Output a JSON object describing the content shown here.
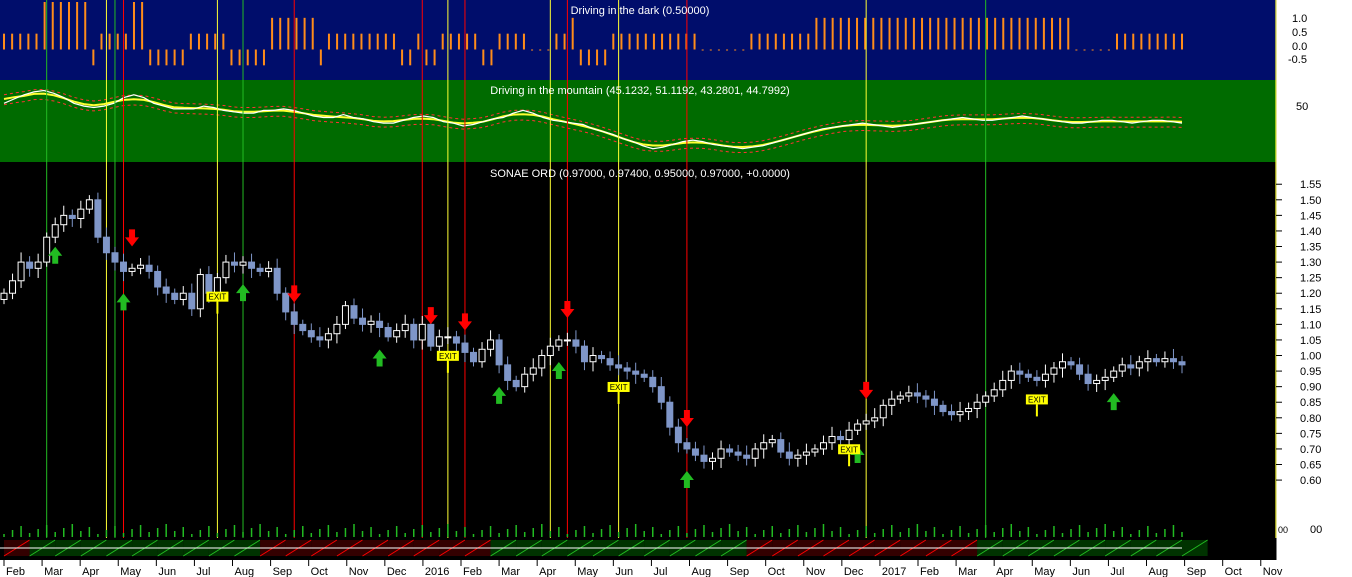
{
  "panels": {
    "dark": {
      "title": "Driving in the dark (0.50000)",
      "ticks": [
        "1.0",
        "0.5",
        "0.0",
        "-0.5"
      ],
      "ylim": [
        -0.9,
        1.5
      ]
    },
    "mountain": {
      "title": "Driving in the mountain (45.1232, 51.1192, 43.2801, 44.7992)",
      "ticks": [
        "50"
      ],
      "ylim": [
        20,
        75
      ]
    },
    "price": {
      "title": "SONAE ORD (0.97000, 0.97400, 0.95000, 0.97000, +0.0000)"
    }
  },
  "colors": {
    "dark_bg": "#000d6b",
    "mountain_bg": "#006b00",
    "price_bg": "#000000",
    "up_candle": "#ffffff",
    "down_candle": "#7f96c8",
    "orange": "#ff8c1a",
    "yellow": "#ffff33",
    "buy": "#22bb22",
    "sell": "#ff0000",
    "exit_bg": "#ffff00"
  },
  "x_axis": {
    "labels": [
      "Feb",
      "Mar",
      "Apr",
      "May",
      "Jun",
      "Jul",
      "Aug",
      "Sep",
      "Oct",
      "Nov",
      "Dec",
      "2016",
      "Feb",
      "Mar",
      "Apr",
      "May",
      "Jun",
      "Jul",
      "Aug",
      "Sep",
      "Oct",
      "Nov",
      "Dec",
      "2017",
      "Feb",
      "Mar",
      "Apr",
      "May",
      "Jun",
      "Jul",
      "Aug",
      "Sep",
      "Oct",
      "Nov"
    ]
  },
  "volume_axis": {
    "labels": [
      "00",
      "00"
    ]
  },
  "exit_label": "EXIT",
  "chart_data": {
    "type": "candlestick",
    "title": "SONAE ORD (0.97000, 0.97400, 0.95000, 0.97000, +0.0000)",
    "x_range": [
      "2015-02",
      "2016-08"
    ],
    "ylim": [
      0.52,
      1.57
    ],
    "y_ticks": [
      "1.55",
      "1.50",
      "1.45",
      "1.40",
      "1.35",
      "1.30",
      "1.25",
      "1.20",
      "1.15",
      "1.10",
      "1.05",
      "1.00",
      "0.95",
      "0.90",
      "0.85",
      "0.80",
      "0.75",
      "0.70",
      "0.65",
      "0.60"
    ],
    "close_series_weekly": [
      1.2,
      1.24,
      1.3,
      1.28,
      1.3,
      1.38,
      1.42,
      1.45,
      1.44,
      1.47,
      1.5,
      1.38,
      1.33,
      1.3,
      1.27,
      1.28,
      1.29,
      1.27,
      1.22,
      1.2,
      1.18,
      1.2,
      1.15,
      1.26,
      1.2,
      1.25,
      1.3,
      1.29,
      1.3,
      1.28,
      1.27,
      1.28,
      1.2,
      1.14,
      1.1,
      1.08,
      1.06,
      1.05,
      1.07,
      1.1,
      1.16,
      1.12,
      1.1,
      1.11,
      1.09,
      1.06,
      1.08,
      1.1,
      1.05,
      1.1,
      1.03,
      1.06,
      1.06,
      1.04,
      1.01,
      0.98,
      1.02,
      1.05,
      0.97,
      0.92,
      0.9,
      0.94,
      0.96,
      1.0,
      1.03,
      1.05,
      1.05,
      1.03,
      0.98,
      1.0,
      0.99,
      0.97,
      0.96,
      0.95,
      0.94,
      0.93,
      0.9,
      0.85,
      0.77,
      0.72,
      0.7,
      0.68,
      0.66,
      0.67,
      0.7,
      0.69,
      0.68,
      0.67,
      0.7,
      0.72,
      0.73,
      0.69,
      0.67,
      0.68,
      0.69,
      0.7,
      0.72,
      0.74,
      0.73,
      0.76,
      0.78,
      0.79,
      0.8,
      0.84,
      0.86,
      0.87,
      0.88,
      0.87,
      0.86,
      0.84,
      0.82,
      0.81,
      0.82,
      0.83,
      0.85,
      0.87,
      0.89,
      0.92,
      0.95,
      0.94,
      0.93,
      0.92,
      0.94,
      0.96,
      0.98,
      0.97,
      0.94,
      0.91,
      0.92,
      0.93,
      0.95,
      0.97,
      0.96,
      0.98,
      0.99,
      0.98,
      0.99,
      0.98,
      0.97
    ],
    "buy_signal_weeks": [
      6,
      14,
      28,
      44,
      58,
      65,
      80,
      100,
      130,
      140
    ],
    "sell_signal_weeks": [
      15,
      34,
      50,
      54,
      66,
      80,
      101
    ],
    "exit_signal_weeks": [
      25,
      52,
      72,
      99,
      121
    ],
    "vertical_markers": {
      "green": [
        5,
        13,
        28,
        115
      ],
      "red": [
        14,
        34,
        49,
        54,
        66,
        80
      ],
      "yellow": [
        12,
        25,
        52,
        64,
        72,
        101,
        149
      ]
    }
  },
  "dark_histogram": {
    "note": "orange bars oscillating between levels",
    "levels_weekly": [
      0.5,
      0.5,
      0.5,
      0.5,
      0.5,
      1.5,
      1.5,
      1.5,
      1.5,
      1.5,
      1.5,
      -0.5,
      0.5,
      0.5,
      0.5,
      0.5,
      1.5,
      1.5,
      -0.5,
      -0.5,
      -0.5,
      -0.5,
      -0.5,
      0.5,
      0.5,
      0.5,
      0.5,
      0.5,
      -0.5,
      -0.5,
      -0.5,
      -0.5,
      -0.5,
      1.0,
      1.0,
      1.0,
      1.0,
      1.0,
      1.0,
      -0.5,
      0.5,
      0.5,
      0.5,
      0.5,
      0.5,
      0.5,
      0.5,
      0.5,
      0.5,
      -0.5,
      -0.5,
      0.5,
      -0.5,
      -0.5,
      0.5,
      0.5,
      0.5,
      0.5,
      0.5,
      -0.5,
      -0.5,
      0.5,
      0.5,
      0.5,
      0.5,
      0.0,
      0.0,
      0.0,
      0.5,
      0.5,
      1.0,
      -0.5,
      -0.5,
      -0.5,
      -0.5,
      0.5,
      0.5,
      0.5,
      0.5,
      0.5,
      0.5,
      0.5,
      0.5,
      0.5,
      0.5,
      0.5,
      0.0,
      0.0,
      0.0,
      0.0,
      0.0,
      0.0,
      0.5,
      0.5,
      0.5,
      0.5,
      0.5,
      0.5,
      0.5,
      0.5,
      1.0,
      1.0,
      1.0,
      1.0,
      1.0,
      1.0,
      1.0,
      1.0,
      1.0,
      1.0,
      1.0,
      1.0,
      1.0,
      1.0,
      1.0,
      1.0,
      1.0,
      1.0,
      1.0,
      1.0,
      1.0,
      1.0,
      1.0,
      1.0,
      1.0,
      1.0,
      1.0,
      1.0,
      1.0,
      1.0,
      1.0,
      1.0,
      0.0,
      0.0,
      0.0,
      0.0,
      0.0,
      0.5,
      0.5,
      0.5,
      0.5,
      0.5,
      0.5,
      0.5,
      0.5,
      0.5
    ]
  },
  "mountain_lines": {
    "white_weekly": [
      60,
      63,
      66,
      68,
      69,
      67,
      64,
      60,
      58,
      57,
      58,
      60,
      64,
      66,
      64,
      60,
      58,
      56,
      56,
      56,
      58,
      57,
      55,
      54,
      53,
      53,
      55,
      55,
      56,
      55,
      53,
      51,
      50,
      50,
      52,
      50,
      49,
      47,
      46,
      46,
      48,
      50,
      51,
      50,
      47,
      46,
      44,
      45,
      47,
      49,
      50,
      53,
      55,
      53,
      50,
      48,
      47,
      46,
      45,
      42,
      40,
      38,
      35,
      33,
      30,
      28,
      29,
      31,
      33,
      34,
      33,
      31,
      30,
      29,
      28,
      29,
      30,
      32,
      34,
      36,
      38,
      40,
      42,
      43,
      44,
      45,
      46,
      45,
      44,
      43,
      44,
      45,
      46,
      47,
      48,
      49,
      50,
      49,
      48,
      48,
      49,
      50,
      51,
      50,
      49,
      48,
      47,
      46,
      46,
      47,
      48,
      48,
      47,
      46,
      47,
      48,
      48,
      47,
      46
    ]
  }
}
